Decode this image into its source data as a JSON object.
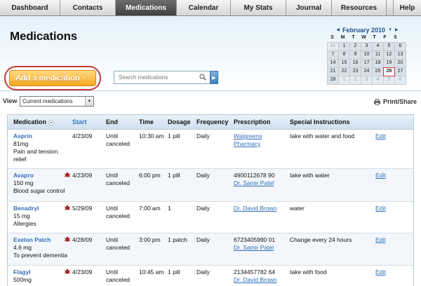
{
  "nav": {
    "tabs": [
      {
        "label": "Dashboard"
      },
      {
        "label": "Contacts"
      },
      {
        "label": "Medications"
      },
      {
        "label": "Calendar"
      },
      {
        "label": "My Stats"
      },
      {
        "label": "Journal"
      },
      {
        "label": "Resources"
      }
    ],
    "help": "Help",
    "active_tab": "Medications",
    "active_color": "#4a4a4a"
  },
  "header": {
    "title": "Medications",
    "add_button": "Add a medication",
    "search_placeholder": "Search medications"
  },
  "calendar": {
    "month_label": "February 2010",
    "weekdays": [
      "S",
      "M",
      "T",
      "W",
      "T",
      "F",
      "S"
    ],
    "days": [
      {
        "d": "31",
        "muted": true
      },
      {
        "d": "1"
      },
      {
        "d": "2"
      },
      {
        "d": "3"
      },
      {
        "d": "4"
      },
      {
        "d": "5"
      },
      {
        "d": "6"
      },
      {
        "d": "7"
      },
      {
        "d": "8"
      },
      {
        "d": "9"
      },
      {
        "d": "10"
      },
      {
        "d": "11"
      },
      {
        "d": "12"
      },
      {
        "d": "13"
      },
      {
        "d": "14"
      },
      {
        "d": "15"
      },
      {
        "d": "16"
      },
      {
        "d": "17"
      },
      {
        "d": "18"
      },
      {
        "d": "19"
      },
      {
        "d": "20"
      },
      {
        "d": "21"
      },
      {
        "d": "22"
      },
      {
        "d": "23"
      },
      {
        "d": "24"
      },
      {
        "d": "25"
      },
      {
        "d": "26",
        "today": true
      },
      {
        "d": "27"
      },
      {
        "d": "28"
      },
      {
        "d": "1",
        "muted": true
      },
      {
        "d": "2",
        "muted": true
      },
      {
        "d": "3",
        "muted": true
      },
      {
        "d": "4",
        "muted": true
      },
      {
        "d": "5",
        "muted": true
      },
      {
        "d": "6",
        "muted": true
      }
    ]
  },
  "view": {
    "label": "View",
    "selected": "Current medications",
    "print_label": "Print/Share"
  },
  "table": {
    "headers": {
      "medication": "Medication",
      "start": "Start",
      "end": "End",
      "time": "Time",
      "dosage": "Dosage",
      "frequency": "Frequency",
      "prescription": "Prescription",
      "special": "Special Instructions"
    },
    "rows": [
      {
        "name": "Asprin",
        "dose": "81mg",
        "purpose": "Pain and tension relief",
        "alert": false,
        "start": "4/23/09",
        "end": "Until canceled",
        "time": "10:30 am",
        "dosage": "1 pill",
        "frequency": "Daily",
        "rx_number": "",
        "rx_link": "Walgreens Pharmacy",
        "special": "take with water and food",
        "edit": "Edit"
      },
      {
        "name": "Avapro",
        "dose": "150 mg",
        "purpose": "Blood sugar control",
        "alert": true,
        "start": "4/23/09",
        "end": "Until canceled",
        "time": "6:00 pm",
        "dosage": "1 pill",
        "frequency": "Daily",
        "rx_number": "4900112678 90",
        "rx_link": "Dr. Samir Patel",
        "special": "take with water",
        "edit": "Edit"
      },
      {
        "name": "Benadryl",
        "dose": "15 mg",
        "purpose": "Allergies",
        "alert": true,
        "start": "5/29/09",
        "end": "Until canceled",
        "time": "7:00 am",
        "dosage": "1",
        "frequency": "Daily",
        "rx_number": "",
        "rx_link": "Dr. David Brown",
        "special": "water",
        "edit": "Edit"
      },
      {
        "name": "Exelon Patch",
        "dose": "4.6 mg",
        "purpose": "To prevent dementia",
        "alert": true,
        "start": "4/28/09",
        "end": "Until canceled",
        "time": "3:00 pm",
        "dosage": "1 patch",
        "frequency": "Daily",
        "rx_number": "6723405990 01",
        "rx_link": "Dr. Samir Patel",
        "special": "Change every 24 hours",
        "edit": "Edit"
      },
      {
        "name": "Flagyl",
        "dose": "500mg",
        "purpose": "",
        "alert": true,
        "start": "4/23/09",
        "end": "Until canceled",
        "time": "10:45 am",
        "dosage": "1 pill",
        "frequency": "Daily",
        "rx_number": "2134457782 64",
        "rx_link": "Dr. David Brown",
        "special": "take with food",
        "edit": "Edit"
      }
    ]
  },
  "colors": {
    "accent": "#2f6db6",
    "add_button": "#f6a91e",
    "highlight_ring": "#c43a3a"
  },
  "icons": {
    "search": "search-icon",
    "alert": "bug-alert-icon",
    "print": "printer-icon",
    "sort": "sort-arrow-icon"
  }
}
